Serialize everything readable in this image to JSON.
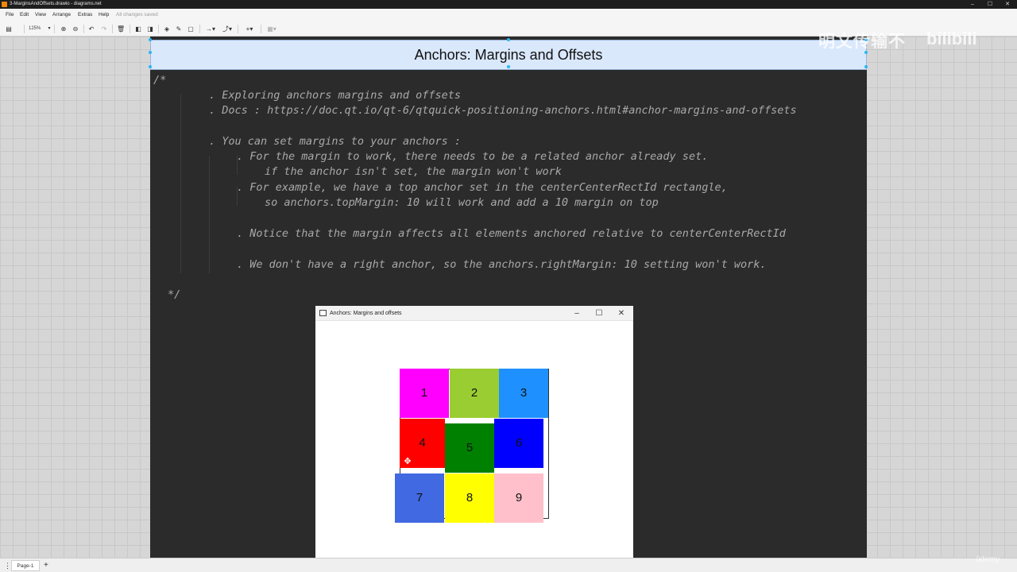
{
  "window": {
    "title": "3-MarginsAndOffsets.drawio - diagrams.net",
    "app_icon": "drawio-icon"
  },
  "menu": {
    "items": [
      "File",
      "Edit",
      "View",
      "Arrange",
      "Extras",
      "Help"
    ],
    "status": "All changes saved"
  },
  "toolbar": {
    "zoom": "125%"
  },
  "diagram": {
    "header_title": "Anchors: Margins and Offsets",
    "code_lines": [
      "/*",
      ". Exploring anchors margins and offsets",
      ". Docs : https://doc.qt.io/qt-6/qtquick-positioning-anchors.html#anchor-margins-and-offsets",
      ". You can set margins to your anchors :",
      ". For the margin to work, there needs to be a related anchor already set.",
      "if the anchor isn't set, the margin won't work",
      ". For example, we have a top anchor set in the centerCenterRectId rectangle,",
      "so anchors.topMargin: 10 will work and add a 10 margin on top",
      ". Notice that the margin affects all elements anchored relative to centerCenterRectId",
      ". We don't have a right anchor, so the anchors.rightMargin: 10 setting won't work.",
      "*/"
    ]
  },
  "app_window": {
    "title": "Anchors: Margins and offsets",
    "controls": [
      "–",
      "☐",
      "✕"
    ],
    "cells": [
      {
        "label": "1",
        "color": "#ff00ff"
      },
      {
        "label": "2",
        "color": "#9acd32"
      },
      {
        "label": "3",
        "color": "#1e90ff"
      },
      {
        "label": "4",
        "color": "#ff0000"
      },
      {
        "label": "5",
        "color": "#008000"
      },
      {
        "label": "6",
        "color": "#0000ff"
      },
      {
        "label": "7",
        "color": "#4169e1"
      },
      {
        "label": "8",
        "color": "#ffff00"
      },
      {
        "label": "9",
        "color": "#ffc0cb"
      }
    ]
  },
  "pagebar": {
    "page": "Page-1",
    "menu_icon": "⋮",
    "add_icon": "+"
  },
  "overlays": {
    "watermark_text": "明文传输不",
    "watermark_logo": "bilibili",
    "udemy": "ûdemy"
  }
}
